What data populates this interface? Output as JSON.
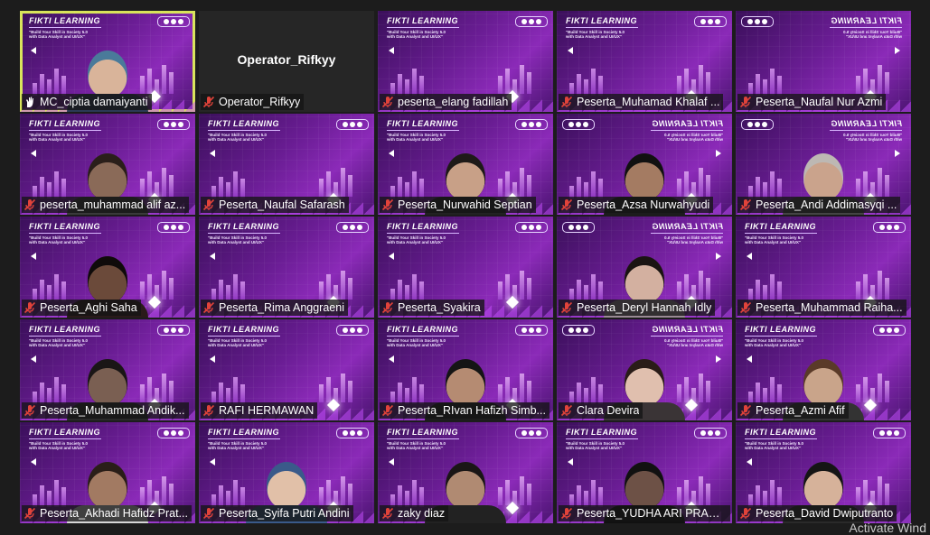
{
  "banner": {
    "title": "FIKTI LEARNING",
    "subtitle_line1": "\"Build Your Skill in Society 5.0",
    "subtitle_line2": "with Data Analyst and UI/UX\""
  },
  "colors": {
    "active_border": "#d8e35a",
    "muted_mic": "#e0433a",
    "hand_raised": "#ffffff"
  },
  "participants": [
    {
      "name": "MC_ciptia damaiyanti",
      "icon": "hand-raise-icon"
    },
    {
      "name": "Operator_Rifkyy",
      "icon": "mic-muted-icon",
      "center_label": "Operator_Rifkyy"
    },
    {
      "name": "peserta_elang fadillah",
      "icon": "mic-muted-icon"
    },
    {
      "name": "Peserta_Muhamad Khalaf ...",
      "icon": "mic-muted-icon"
    },
    {
      "name": "Peserta_Naufal Nur Azmi",
      "icon": "mic-muted-icon"
    },
    {
      "name": "peserta_muhammad alif az...",
      "icon": "mic-muted-icon"
    },
    {
      "name": "Peserta_Naufal Safarash",
      "icon": "mic-muted-icon"
    },
    {
      "name": "Peserta_Nurwahid Septian",
      "icon": "mic-muted-icon"
    },
    {
      "name": "Peserta_Azsa Nurwahyudi",
      "icon": "mic-muted-icon"
    },
    {
      "name": "Peserta_Andi Addimasyqi ...",
      "icon": "mic-muted-icon"
    },
    {
      "name": "Peserta_Aghi Saha",
      "icon": "mic-muted-icon"
    },
    {
      "name": "Peserta_Rima Anggraeni",
      "icon": "mic-muted-icon"
    },
    {
      "name": "Peserta_Syakira",
      "icon": "mic-muted-icon"
    },
    {
      "name": "Peserta_Deryl Hannah Idly",
      "icon": "mic-muted-icon"
    },
    {
      "name": "Peserta_Muhammad Raiha...",
      "icon": "mic-muted-icon"
    },
    {
      "name": "Peserta_Muhammad Andik...",
      "icon": "mic-muted-icon"
    },
    {
      "name": "RAFI HERMAWAN",
      "icon": "mic-muted-icon"
    },
    {
      "name": "Peserta_RIvan Hafizh Simb...",
      "icon": "mic-muted-icon"
    },
    {
      "name": "Clara Devira",
      "icon": "mic-muted-icon"
    },
    {
      "name": "Peserta_Azmi Afif",
      "icon": "mic-muted-icon"
    },
    {
      "name": "Peserta_Akhadi Hafidz Prat...",
      "icon": "mic-muted-icon"
    },
    {
      "name": "Peserta_Syifa Putri Andini",
      "icon": "mic-muted-icon"
    },
    {
      "name": "zaky diaz",
      "icon": "mic-muted-icon"
    },
    {
      "name": "Peserta_YUDHA ARI PRASE...",
      "icon": "mic-muted-icon"
    },
    {
      "name": "Peserta_David Dwiputranto",
      "icon": "mic-muted-icon"
    }
  ],
  "watermark": "Activate Wind"
}
